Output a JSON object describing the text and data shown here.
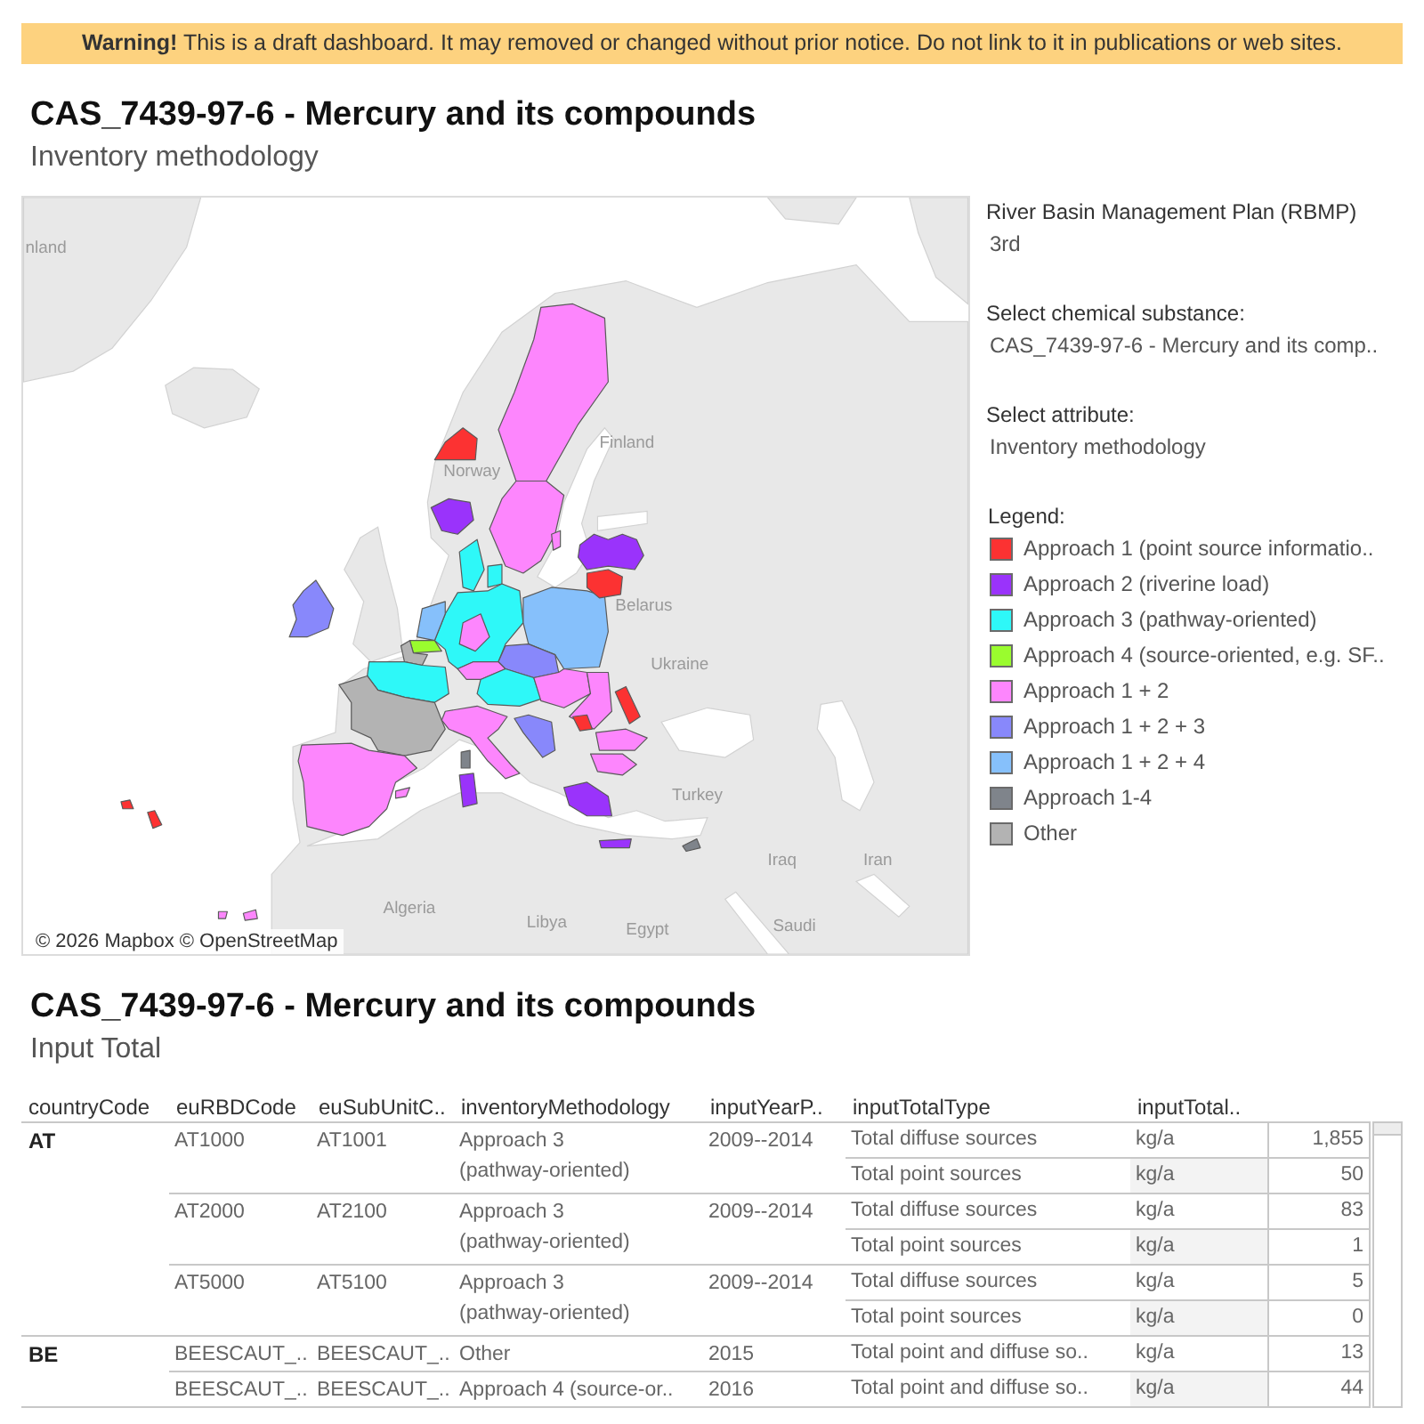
{
  "warning_banner": {
    "text": "**Warning!** This is a draft dashboard. It may removed or changed without prior notice. Do not link to it in publications or web sites."
  },
  "map_section": {
    "title": "CAS_7439-97-6 - Mercury and its compounds",
    "subtitle": "Inventory methodology",
    "map": {
      "place_labels": [
        "nland",
        "Finland",
        "Norway",
        "Belarus",
        "Ukraine",
        "Turkey",
        "Iraq",
        "Iran",
        "Algeria",
        "Libya",
        "Egypt",
        "Saudi"
      ],
      "attribution": "© 2026 Mapbox © OpenStreetMap"
    }
  },
  "filters": [
    {
      "label": "River Basin Management Plan (RBMP)",
      "value": "3rd"
    },
    {
      "label": "Select chemical substance:",
      "value": "CAS_7439-97-6 - Mercury and its comp.."
    },
    {
      "label": "Select attribute:",
      "value": "Inventory methodology"
    }
  ],
  "legend": {
    "title": "Legend:",
    "items": [
      {
        "label": "Approach 1 (point source informatio..",
        "color": "#fc3232"
      },
      {
        "label": "Approach 2 (riverine load)",
        "color": "#9a33fb"
      },
      {
        "label": "Approach 3 (pathway-oriented)",
        "color": "#2ef8f8"
      },
      {
        "label": "Approach 4 (source-oriented, e.g. SF..",
        "color": "#9afc2e"
      },
      {
        "label": "Approach 1 + 2",
        "color": "#fd86fd"
      },
      {
        "label": "Approach 1 + 2 + 3",
        "color": "#8888fb"
      },
      {
        "label": "Approach 1 + 2 + 4",
        "color": "#86c0fb"
      },
      {
        "label": "Approach 1-4",
        "color": "#7f848b"
      },
      {
        "label": "Other",
        "color": "#b3b3b3"
      }
    ]
  },
  "table_section": {
    "title": "CAS_7439-97-6 - Mercury and its compounds",
    "subtitle": "Input Total",
    "table": {
      "columns": [
        "countryCode",
        "euRBDCode",
        "euSubUnitC..",
        "inventoryMethodology",
        "inputYearP..",
        "inputTotalType",
        "inputTotal.."
      ],
      "groups": [
        {
          "country": "AT",
          "units": [
            {
              "rbd": "AT1000",
              "subunit": "AT1001",
              "methodology": "Approach 3 (pathway-oriented)",
              "period": "2009--2014",
              "rows": [
                {
                  "type": "Total diffuse sources",
                  "unit": "kg/a",
                  "value": "1,855"
                },
                {
                  "type": "Total point sources",
                  "unit": "kg/a",
                  "value": "50"
                }
              ]
            },
            {
              "rbd": "AT2000",
              "subunit": "AT2100",
              "methodology": "Approach 3 (pathway-oriented)",
              "period": "2009--2014",
              "rows": [
                {
                  "type": "Total diffuse sources",
                  "unit": "kg/a",
                  "value": "83"
                },
                {
                  "type": "Total point sources",
                  "unit": "kg/a",
                  "value": "1"
                }
              ]
            },
            {
              "rbd": "AT5000",
              "subunit": "AT5100",
              "methodology": "Approach 3 (pathway-oriented)",
              "period": "2009--2014",
              "rows": [
                {
                  "type": "Total diffuse sources",
                  "unit": "kg/a",
                  "value": "5"
                },
                {
                  "type": "Total point sources",
                  "unit": "kg/a",
                  "value": "0"
                }
              ]
            }
          ]
        },
        {
          "country": "BE",
          "units": [
            {
              "rbd": "BEESCAUT_..",
              "subunit": "BEESCAUT_..",
              "methodology": "Other",
              "period": "2015",
              "rows": [
                {
                  "type": "Total point and diffuse so..",
                  "unit": "kg/a",
                  "value": "13"
                }
              ]
            },
            {
              "rbd": "BEESCAUT_..",
              "subunit": "BEESCAUT_..",
              "methodology": "Approach 4 (source-or..",
              "period": "2016",
              "rows": [
                {
                  "type": "Total point and diffuse so..",
                  "unit": "kg/a",
                  "value": "44"
                }
              ]
            }
          ]
        }
      ]
    }
  }
}
